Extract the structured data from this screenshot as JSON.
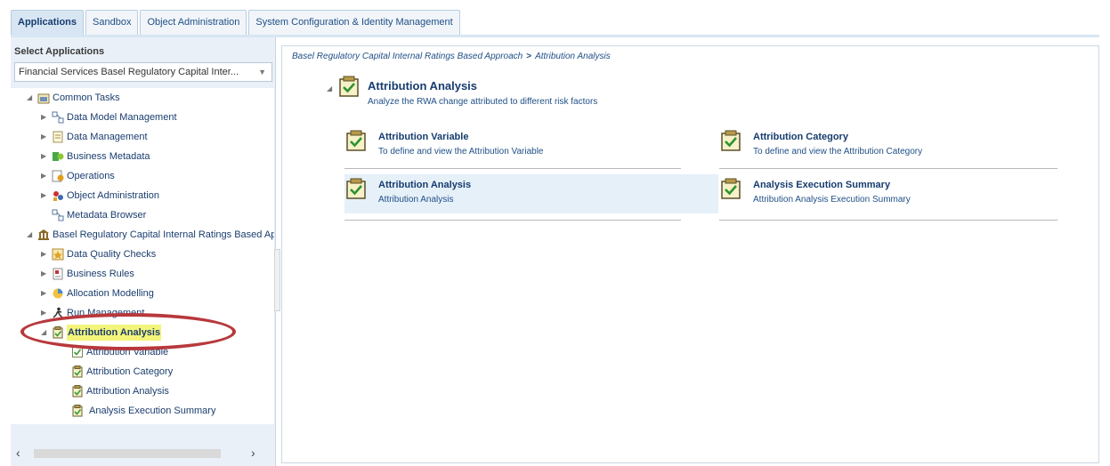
{
  "tabs": [
    "Applications",
    "Sandbox",
    "Object Administration",
    "System Configuration & Identity Management"
  ],
  "left": {
    "select_label": "Select Applications",
    "select_value": "Financial Services Basel Regulatory Capital Inter...",
    "tree": {
      "common_tasks": "Common Tasks",
      "data_model_management": "Data Model Management",
      "data_management": "Data Management",
      "business_metadata": "Business Metadata",
      "operations": "Operations",
      "object_administration": "Object Administration",
      "metadata_browser": "Metadata Browser",
      "basel_root": "Basel Regulatory Capital Internal Ratings Based Ap",
      "data_quality_checks": "Data Quality Checks",
      "business_rules": "Business Rules",
      "allocation_modelling": "Allocation Modelling",
      "run_management": "Run Management",
      "attribution_analysis": "Attribution Analysis",
      "attribution_variable": "Attribution Variable",
      "attribution_category": "Attribution Category",
      "attribution_analysis_child": "Attribution Analysis",
      "analysis_execution_summary": "Analysis Execution Summary"
    }
  },
  "main": {
    "breadcrumb_root": "Basel Regulatory Capital Internal Ratings Based Approach",
    "breadcrumb_sep": ">",
    "breadcrumb_current": "Attribution Analysis",
    "header_title": "Attribution Analysis",
    "header_desc": "Analyze the RWA change attributed to different risk factors",
    "cards": [
      {
        "title": "Attribution Variable",
        "desc": "To define and view the Attribution Variable"
      },
      {
        "title": "Attribution Category",
        "desc": "To define and view the Attribution Category"
      },
      {
        "title": "Attribution Analysis",
        "desc": "Attribution Analysis"
      },
      {
        "title": "Analysis Execution Summary",
        "desc": "Attribution Analysis Execution Summary"
      }
    ]
  },
  "colors": {
    "highlight": "#f4f47a",
    "circle": "#b8383c",
    "selected_card": "#e6f0f9"
  }
}
